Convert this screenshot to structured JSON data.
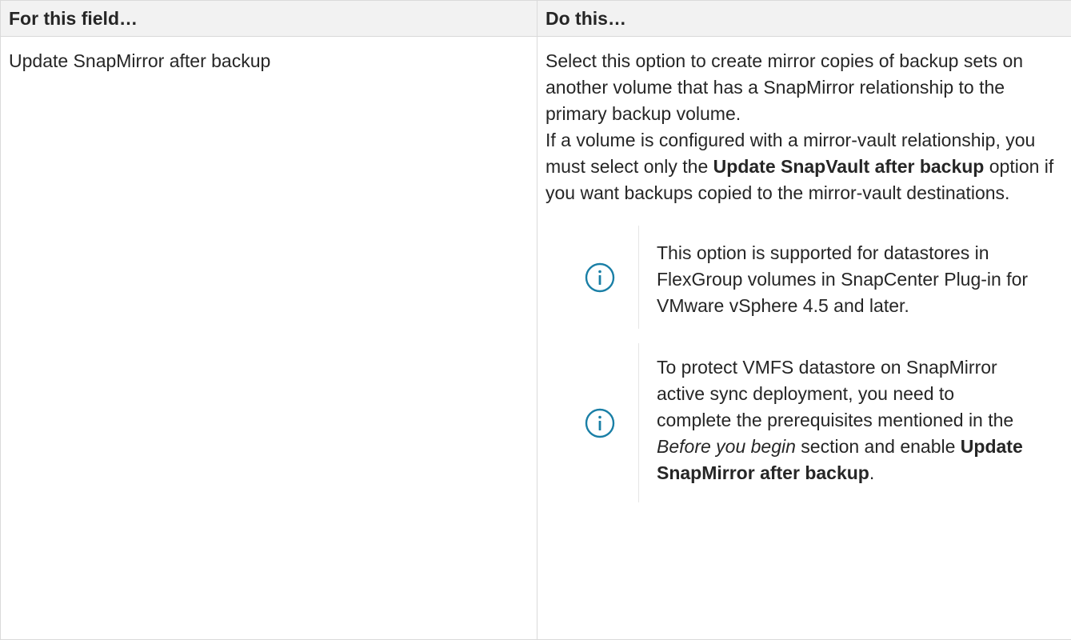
{
  "table": {
    "headers": {
      "field": "For this field…",
      "action": "Do this…"
    },
    "row": {
      "field": "Update SnapMirror after backup",
      "action": {
        "intro_1": "Select this option to create mirror copies of backup sets on another volume that has a SnapMirror relationship to the primary backup volume.",
        "intro_2_before": "If a volume is configured with a mirror-vault relationship, you must select only the ",
        "intro_2_bold": "Update SnapVault after backup",
        "intro_2_after": " option if you want backups copied to the mirror-vault destinations.",
        "note_1": {
          "icon": "info-icon",
          "text": "This option is supported for datastores in FlexGroup volumes in SnapCenter Plug-in for VMware vSphere 4.5 and later."
        },
        "note_2": {
          "icon": "info-icon",
          "text_before": "To protect VMFS datastore on SnapMirror active sync deployment, you need to complete the prerequisites mentioned in the ",
          "text_italic": "Before you begin",
          "text_middle": " section and enable ",
          "text_bold": "Update SnapMirror after backup",
          "text_after": "."
        }
      }
    }
  },
  "colors": {
    "header_bg": "#f2f2f2",
    "border": "#dadada",
    "text": "#262626",
    "icon": "#1a7fa6"
  }
}
